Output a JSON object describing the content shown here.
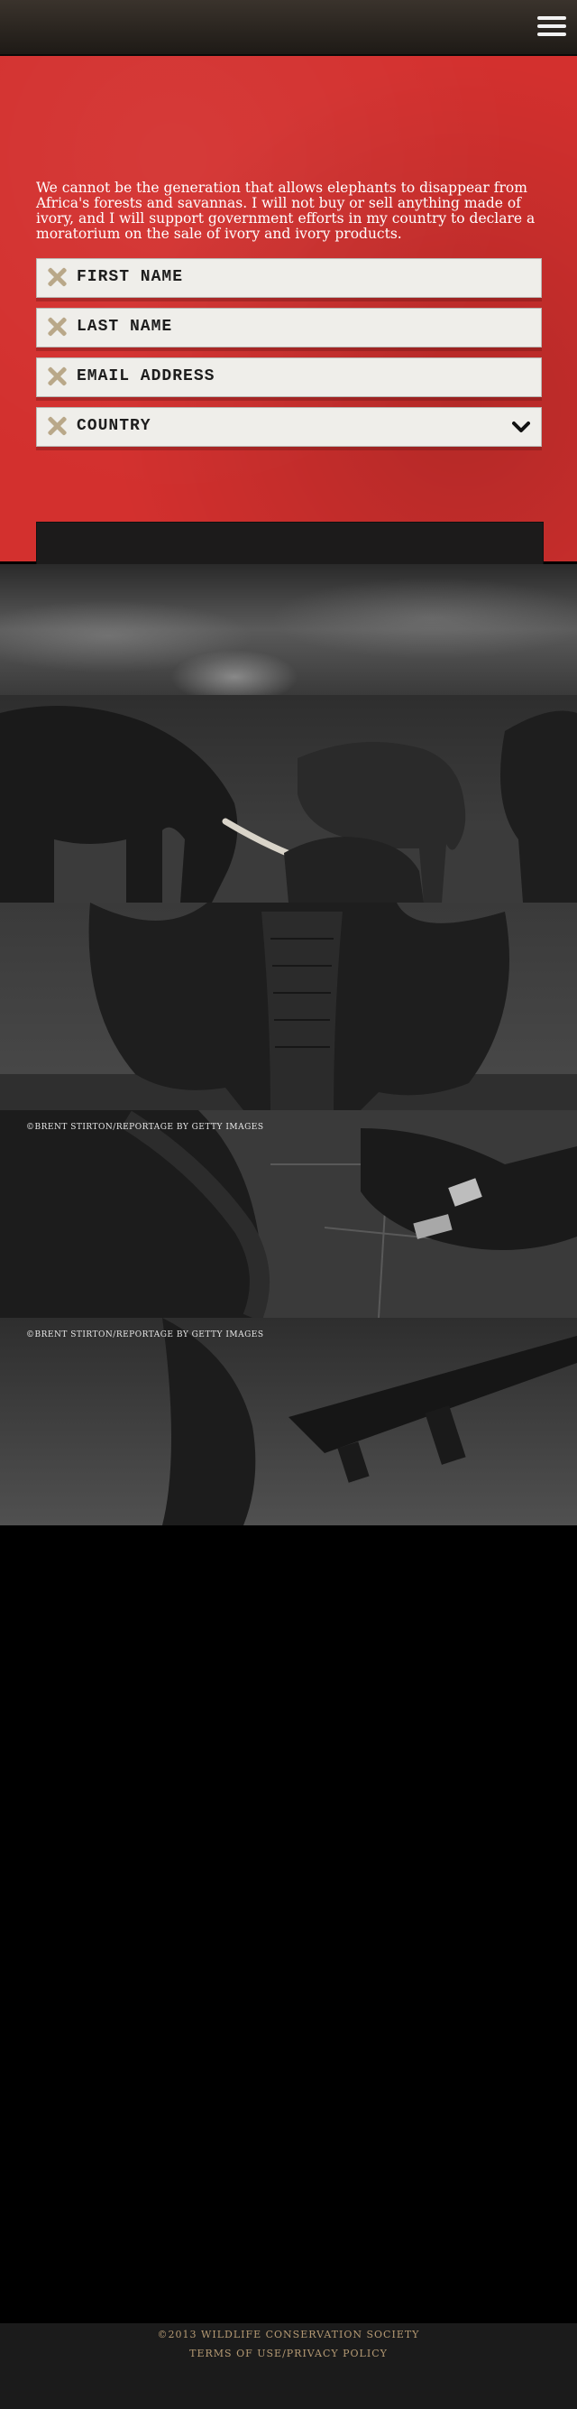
{
  "header": {
    "menu_icon": "hamburger-icon"
  },
  "pledge": {
    "text": "We cannot be the generation that allows elephants to disappear from Africa's forests and savannas. I will not buy or sell anything made of ivory, and I will support government efforts in my country to declare a moratorium on the sale of ivory and ivory products.",
    "fields": {
      "first_name": "FIRST NAME",
      "last_name": "LAST NAME",
      "email": "EMAIL ADDRESS",
      "country": "COUNTRY"
    },
    "field_icon": "x-icon",
    "country_icon": "chevron-down-icon",
    "accent_color": "#d3302e"
  },
  "photos": {
    "caption_1": "©BRENT STIRTON/REPORTAGE BY GETTY IMAGES",
    "caption_2": "©BRENT STIRTON/REPORTAGE BY GETTY IMAGES"
  },
  "footer": {
    "copyright": "©2013 WILDLIFE CONSERVATION SOCIETY",
    "terms": "TERMS OF USE",
    "separator": "/",
    "privacy": "PRIVACY POLICY"
  }
}
